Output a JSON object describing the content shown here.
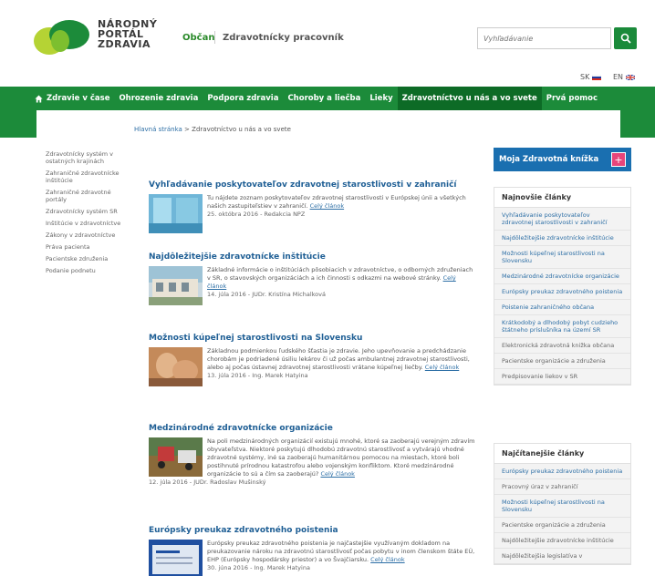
{
  "header": {
    "logo_line1": "NÁRODNÝ",
    "logo_line2": "PORTÁL",
    "logo_line3": "ZDRAVIA",
    "tab_citizen": "Občan",
    "tab_worker": "Zdravotnícky pracovník",
    "search_placeholder": "Vyhľadávanie",
    "lang_sk": "SK",
    "lang_en": "EN"
  },
  "nav": {
    "items": [
      "Zdravie v čase",
      "Ohrozenie zdravia",
      "Podpora zdravia",
      "Choroby a liečba",
      "Lieky",
      "Zdravotníctvo u nás a vo svete",
      "Prvá pomoc"
    ]
  },
  "breadcrumb": {
    "home": "Hlavná stránka",
    "separator": ">",
    "current": "Zdravotníctvo u nás a vo svete"
  },
  "left_menu": [
    "Zdravotnícky systém v ostatných krajinách",
    "Zahraničné zdravotnícke inštitúcie",
    "Zahraničné zdravotné portály",
    "Zdravotnícky systém SR",
    "Inštitúcie v zdravotníctve",
    "Zákony v zdravotníctve",
    "Práva pacienta",
    "Pacientske združenia",
    "Podanie podnetu"
  ],
  "articles": [
    {
      "title": "Vyhľadávanie poskytovateľov zdravotnej starostlivosti v zahraničí",
      "text": "Tu nájdete zoznam poskytovateľov zdravotnej starostlivosti v Európskej únii a všetkých našich zastupiteľstiev v zahraničí.",
      "more": "Celý článok",
      "meta": "25. októbra 2016 - Redakcia NPZ"
    },
    {
      "title": "Najdôležitejšie zdravotnícke inštitúcie",
      "text": "Základné informácie o inštitúciách pôsobiacich v zdravotníctve, o odborných združeniach v SR, o stavovských organizáciách a ich činnosti s odkazmi na webové stránky.",
      "more": "Celý článok",
      "meta": "14. júla 2016 - JUDr. Kristína Michalková"
    },
    {
      "title": "Možnosti kúpeľnej starostlivosti na Slovensku",
      "text": "Základnou podmienkou ľudského šťastia je zdravie. Jeho upevňovanie a predchádzanie chorobám je podriadené úsiliu lekárov či už počas ambulantnej zdravotnej starostlivosti, alebo aj počas ústavnej zdravotnej starostlivosti vrátane kúpeľnej liečby.",
      "more": "Celý článok",
      "meta": "13. júla 2016 - Ing. Marek Hatyina"
    },
    {
      "title": "Medzinárodné zdravotnícke organizácie",
      "text": "Na poli medzinárodných organizácií existujú mnohé, ktoré sa zaoberajú verejným zdravím obyvateľstva. Niektoré poskytujú dlhodobú zdravotnú starostlivosť a vytvárajú vhodné zdravotné systémy, iné sa zaoberajú humanitárnou pomocou na miestach, ktoré boli postihnuté prírodnou katastrofou alebo vojenským konfliktom. Ktoré medzinárodné organizácie to sú a čím sa zaoberajú?",
      "more": "Celý článok",
      "meta": "12. júla 2016 - JUDr. Radoslav Mušinský"
    },
    {
      "title": "Európsky preukaz zdravotného poistenia",
      "text": "Európsky preukaz zdravotného poistenia je najčastejšie využívaným dokladom na preukazovanie nároku na zdravotnú starostlivosť počas pobytu v inom členskom štáte EÚ, EHP (Európsky hospodársky priestor) a vo Švajčiarsku.",
      "more": "Celý článok",
      "meta": "30. júna 2016 - Ing. Marek Hatyina"
    }
  ],
  "right": {
    "moja_label": "Moja Zdravotná knížka",
    "moja_plus": "+",
    "newest_title": "Najnovšie články",
    "newest": [
      "Vyhľadávanie poskytovateľov zdravotnej starostlivosti v zahraničí",
      "Najdôležitejšie zdravotnícke inštitúcie",
      "Možnosti kúpeľnej starostlivosti na Slovensku",
      "Medzinárodné zdravotnícke organizácie",
      "Európsky preukaz zdravotného poistenia",
      "Poistenie zahraničného občana",
      "Krátkodobý a dlhodobý pobyt cudzieho štátneho príslušníka na území SR",
      "Elektronická zdravotná knižka občana",
      "Pacientske organizácie a združenia",
      "Predpisovanie liekov v SR"
    ],
    "popular_title": "Najčítanejšie články",
    "popular": [
      "Európsky preukaz zdravotného poistenia",
      "Pracovný úraz v zahraničí",
      "Možnosti kúpeľnej starostlivosti na Slovensku",
      "Pacientske organizácie a združenia",
      "Najdôležitejšie zdravotnícke inštitúcie",
      "Najdôležitejšia legislatíva v"
    ]
  },
  "colors": {
    "brand_green": "#1c8b3a",
    "nav_active": "#0d6b26",
    "link_blue": "#2c6ea5",
    "moja_blue": "#1a6fb0",
    "plus_pink": "#e8457a"
  }
}
